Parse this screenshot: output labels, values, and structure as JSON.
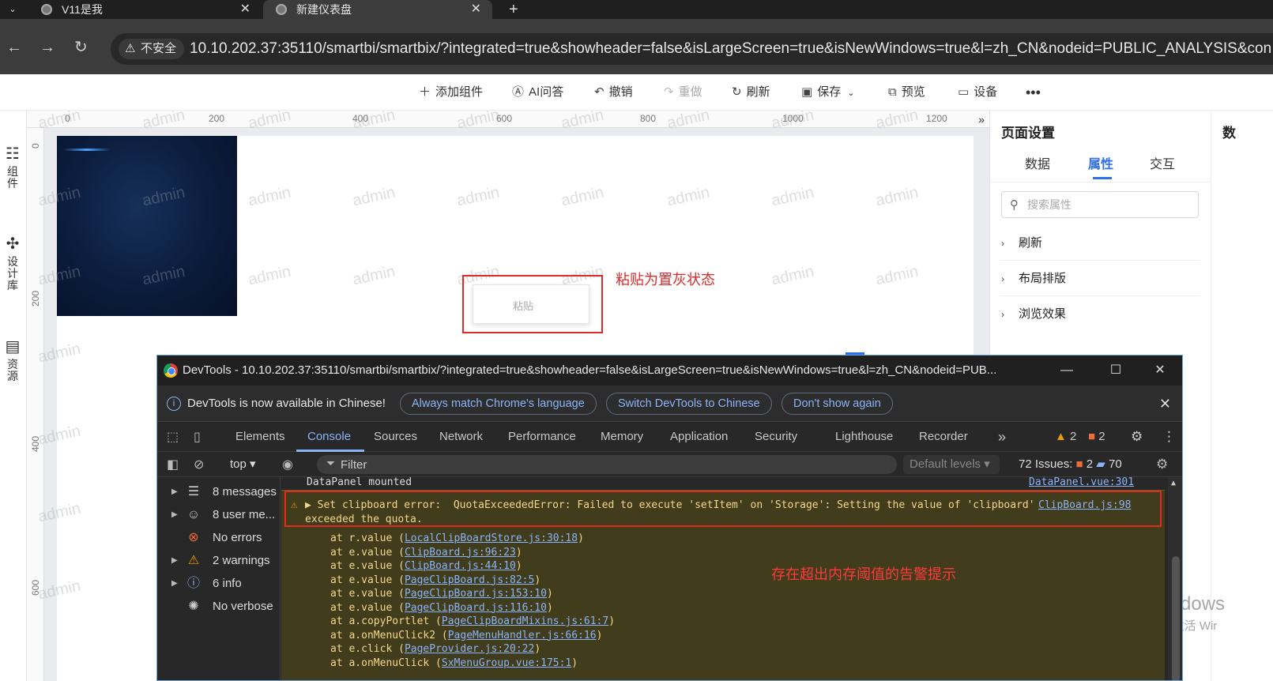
{
  "browser": {
    "tabs": [
      {
        "title": "V11是我"
      },
      {
        "title": "新建仪表盘"
      }
    ],
    "address": {
      "security_label": "不安全",
      "url": "10.10.202.37:35110/smartbi/smartbix/?integrated=true&showheader=false&isLargeScreen=true&isNewWindows=true&l=zh_CN&nodeid=PUBLIC_ANALYSIS&con"
    }
  },
  "toolbar": {
    "add_component": "添加组件",
    "ai_qa": "AI问答",
    "undo": "撤销",
    "redo": "重做",
    "refresh": "刷新",
    "save": "保存",
    "preview": "预览",
    "device": "设备"
  },
  "left_rail": {
    "components": "组件",
    "design_library": "设计库",
    "resources": "资源"
  },
  "canvas": {
    "ruler_top": [
      "0",
      "200",
      "400",
      "600",
      "800",
      "1000",
      "1200"
    ],
    "ruler_left": [
      "0",
      "200",
      "400",
      "600"
    ],
    "watermark": "admin",
    "context_menu": {
      "paste": "粘贴"
    },
    "annotation": "粘贴为置灰状态"
  },
  "right_panel": {
    "title": "页面设置",
    "tabs": [
      "数据",
      "属性",
      "交互"
    ],
    "active_tab": "属性",
    "search_placeholder": "搜索属性",
    "sections": [
      "刷新",
      "布局排版",
      "浏览效果"
    ],
    "edge_title": "数"
  },
  "windows_activation": {
    "line1": "激活 Windows",
    "line2": "转到\"设置\"以激活 Wir"
  },
  "devtools": {
    "window_title": "DevTools - 10.10.202.37:35110/smartbi/smartbix/?integrated=true&showheader=false&isLargeScreen=true&isNewWindows=true&l=zh_CN&nodeid=PUB...",
    "infobar": {
      "text": "DevTools is now available in Chinese!",
      "buttons": [
        "Always match Chrome's language",
        "Switch DevTools to Chinese",
        "Don't show again"
      ]
    },
    "tabs": [
      "Elements",
      "Console",
      "Sources",
      "Network",
      "Performance",
      "Memory",
      "Application",
      "Security",
      "Lighthouse",
      "Recorder"
    ],
    "active_tab": "Console",
    "counters": {
      "warnings": "2",
      "errors": "2"
    },
    "filter": {
      "context": "top",
      "placeholder": "Filter",
      "levels": "Default levels",
      "issues_label": "72 Issues:",
      "issues_errors": "2",
      "issues_info": "70"
    },
    "sidebar": [
      {
        "label": "8 messages",
        "icon": "list-icon",
        "expandable": true
      },
      {
        "label": "8 user me...",
        "icon": "user-icon",
        "expandable": true
      },
      {
        "label": "No errors",
        "icon": "error-icon",
        "expandable": false
      },
      {
        "label": "2 warnings",
        "icon": "warning-icon",
        "expandable": true
      },
      {
        "label": "6 info",
        "icon": "info-icon",
        "expandable": true
      },
      {
        "label": "No verbose",
        "icon": "bug-icon",
        "expandable": false
      }
    ],
    "console": {
      "line1": "DataPanel mounted",
      "line1_source": "DataPanel.vue:301",
      "warning_message": "Set clipboard error:  QuotaExceededError: Failed to execute 'setItem' on 'Storage': Setting the value of 'clipboard'",
      "warning_message_cont": "exceeded the quota.",
      "warning_source": "ClipBoard.js:98",
      "stack": [
        {
          "fn": "at r.value",
          "src": "LocalClipBoardStore.js:30:18"
        },
        {
          "fn": "at e.value",
          "src": "ClipBoard.js:96:23"
        },
        {
          "fn": "at e.value",
          "src": "ClipBoard.js:44:10"
        },
        {
          "fn": "at e.value",
          "src": "PageClipBoard.js:82:5"
        },
        {
          "fn": "at e.value",
          "src": "PageClipBoard.js:153:10"
        },
        {
          "fn": "at e.value",
          "src": "PageClipBoard.js:116:10"
        },
        {
          "fn": "at a.copyPortlet",
          "src": "PageClipBoardMixins.js:61:7"
        },
        {
          "fn": "at a.onMenuClick2",
          "src": "PageMenuHandler.js:66:16"
        },
        {
          "fn": "at e.click",
          "src": "PageProvider.js:20:22"
        },
        {
          "fn": "at a.onMenuClick",
          "src": "SxMenuGroup.vue:175:1"
        }
      ],
      "annotation": "存在超出内存阈值的告警提示"
    }
  }
}
